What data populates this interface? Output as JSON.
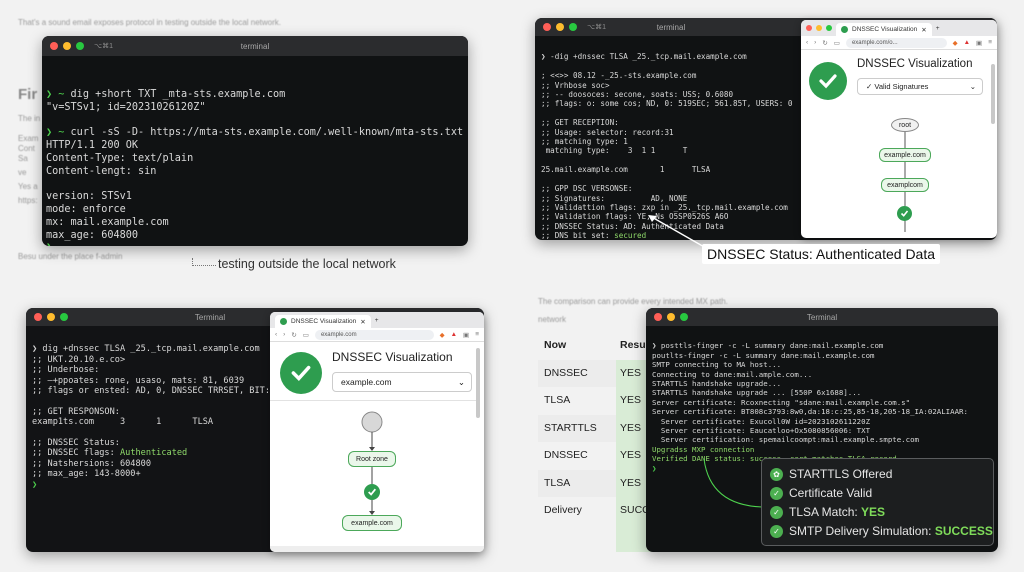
{
  "bg_text": {
    "top_left_intro": "That's a sound email exposes protocol in testing outside the local network.",
    "left_heading": "Fir",
    "left_blur_lines": [
      "The in",
      "Exam",
      "Cont",
      "Sa",
      "ve",
      "Yes a",
      "https:"
    ],
    "left_caption_small": "Besu under the place f-admin",
    "caption": "testing outside the local network",
    "bottom_right_intro": "The comparison can provide every intended MX path.",
    "bottom_right_intro2": "network"
  },
  "term1": {
    "title": "terminal",
    "shortcut": "⌥⌘1",
    "lines": [
      {
        "p": "❯ ~ ",
        "t": "dig +short TXT _mta-sts.example.com"
      },
      {
        "p": "",
        "t": "\"v=STSv1; id=20231026120Z\""
      },
      {
        "p": "",
        "t": ""
      },
      {
        "p": "❯ ~ ",
        "t": "curl -sS -D- https://mta-sts.example.com/.well-known/mta-sts.txt"
      },
      {
        "p": "",
        "t": "HTTP/1.1 200 OK"
      },
      {
        "p": "",
        "t": "Content-Type: text/plain"
      },
      {
        "p": "",
        "t": "Content-lengt: sin"
      },
      {
        "p": "",
        "t": ""
      },
      {
        "p": "",
        "t": "version: STSv1"
      },
      {
        "p": "",
        "t": "mode: enforce"
      },
      {
        "p": "",
        "t": "mx: mail.example.com"
      },
      {
        "p": "",
        "t": "max_age: 604800"
      },
      {
        "p": "❯",
        "t": ""
      }
    ]
  },
  "term2": {
    "title": "terminal",
    "shortcut": "⌥⌘1",
    "lines": [
      "❯ -dig +dnssec TLSA _25._tcp.mail.example.com",
      "",
      "; <<>> 08.12 -_25.-sts.example.com",
      ";; Vrhbose soc>",
      ";; -- doosoces: secone, soats: USS; 0.6080",
      ";; flags: o: some cos; ND, 0: 519SEC; 561.85T, USERS: 0",
      "",
      ";; GET RECEPTION:",
      ";; Usage: selector: record:31",
      ";; matching type: 1",
      " matching type:    3  1 1      T",
      "",
      "25.mail.example.com       1      TLSA",
      "",
      ";; GPP DSC VERSONSE:",
      ";; Signatures:          AD, NONE",
      ";; Validattion flags: zxp in _25._tcp.mail.example.com",
      ";; Validation flags: YE, Ns O5SP0526S A6O",
      ";; DNSSEC Status: AD: Authenticated Data"
    ],
    "last_prefix": ";; DNS bit set: ",
    "last_value": "secured",
    "cursor": "❯"
  },
  "browser1": {
    "tab_label": "DNSSEC Visualization",
    "url": "example.com/o...",
    "heading": "DNSSEC Visualization",
    "select_value": "Valid Signatures",
    "nodes": [
      "root",
      "example.com",
      "examplcom"
    ]
  },
  "callout": {
    "text": "DNSSEC Status: Authenticated Data"
  },
  "term3": {
    "title": "Terminal",
    "lines": [
      "❯ dig +dnssec TLSA _25._tcp.mail.example.com",
      ";; UKT.20.10.e.co>",
      ";; Underbose:",
      ";; —+ppoates: rone, usaso, mats: 81, 6039",
      ";; flags or ensted: AD, 0, DNSSEC TRRSET, BIT:",
      "",
      ";; GET RESPONSON:",
      "examp1ts.com     3      1      TLSA",
      "",
      ";; DNSSEC Status:"
    ],
    "flags_prefix": ";; DNSSEC flags: ",
    "flags_value": "Authenticated",
    "lines2": [
      ";; Natshersions: 604800",
      ";; max_age: 143-8000+"
    ],
    "cursor": "❯"
  },
  "browser2": {
    "tab_label": "DNSSEC Visualization",
    "url": "example.com",
    "heading": "DNSSEC Visualization",
    "select_value": "example.com",
    "nodes": [
      "Root zone",
      "example.com"
    ]
  },
  "table": {
    "col1": "Now",
    "col2": "Resu",
    "rows": [
      {
        "name": "DNSSEC",
        "val": "YES"
      },
      {
        "name": "TLSA",
        "val": "YES"
      },
      {
        "name": "STARTTLS",
        "val": "YES"
      },
      {
        "name": "DNSSEC",
        "val": "YES"
      },
      {
        "name": "TLSA",
        "val": "YES"
      },
      {
        "name": "Delivery",
        "val": "SUCC"
      }
    ]
  },
  "term4": {
    "title": "Terminal",
    "lines": [
      "❯ posttls-finger -c -L summary dane:mail.example.com",
      "poutlts-finger -c -L summary dane:mail.example.com",
      "SMTP connecting to MA host...",
      "Connecting to dane:mail.ample.com...",
      "STARTTLS handshake upgrade...",
      "STARTTLS handshake upgrade ... [550P 6x1688]...",
      "Server certificate: Rcoxnecting \"sdane:mail.example.com.s\"",
      "Server certificate: BT808c3793:8w0,da:18:c:25,85-18,205-18_IA:02ALIAAR:",
      "  Server certificate: Exucoll0W id=2023102611220Z",
      "  Server certificate: Eaucatloo+Ox5080856006: TXT",
      "  Server certification: spemailcoompt:mail.example.smpte.com"
    ],
    "green1": "Upgradss MXP connection",
    "green2": "Verified DANE status: success, cert matches TLSA record",
    "cursor": "❯"
  },
  "summary": {
    "items": [
      {
        "label": "STARTTLS Offered",
        "value": ""
      },
      {
        "label": "Certificate Valid",
        "value": ""
      },
      {
        "label": "TLSA Match: ",
        "value": "YES"
      },
      {
        "label": "SMTP Delivery Simulation: ",
        "value": "SUCCESS"
      }
    ]
  },
  "colors": {
    "green": "#4ed34e",
    "check": "#2e9d4f",
    "accent_ok": "#8fd96a"
  }
}
